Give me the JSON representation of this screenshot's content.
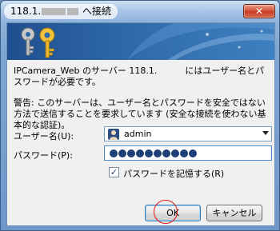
{
  "window": {
    "title_prefix": "118.1.",
    "title_suffix": "へ接続",
    "close_symbol": "✕"
  },
  "message": {
    "text": "IPCamera_Web のサーバー 118.1.          にはユーザー名とパスワードが必要です。",
    "warning": "警告: このサーバーは、ユーザー名とパスワードを安全ではない方法で送信することを要求しています (安全な接続を使わない基本的な認証)。"
  },
  "form": {
    "username_label": "ユーザー名(U):",
    "username_value": "admin",
    "password_label": "パスワード(P):",
    "password_length": 10,
    "remember_label": "パスワードを記憶する(R)",
    "remember_checked": true
  },
  "buttons": {
    "ok": "OK",
    "cancel": "キャンセル"
  },
  "icons": {
    "banner": "keys-icon",
    "user": "user-avatar-icon",
    "dropdown": "chevron-down-icon"
  },
  "colors": {
    "annotation_circle": "#e81414"
  }
}
